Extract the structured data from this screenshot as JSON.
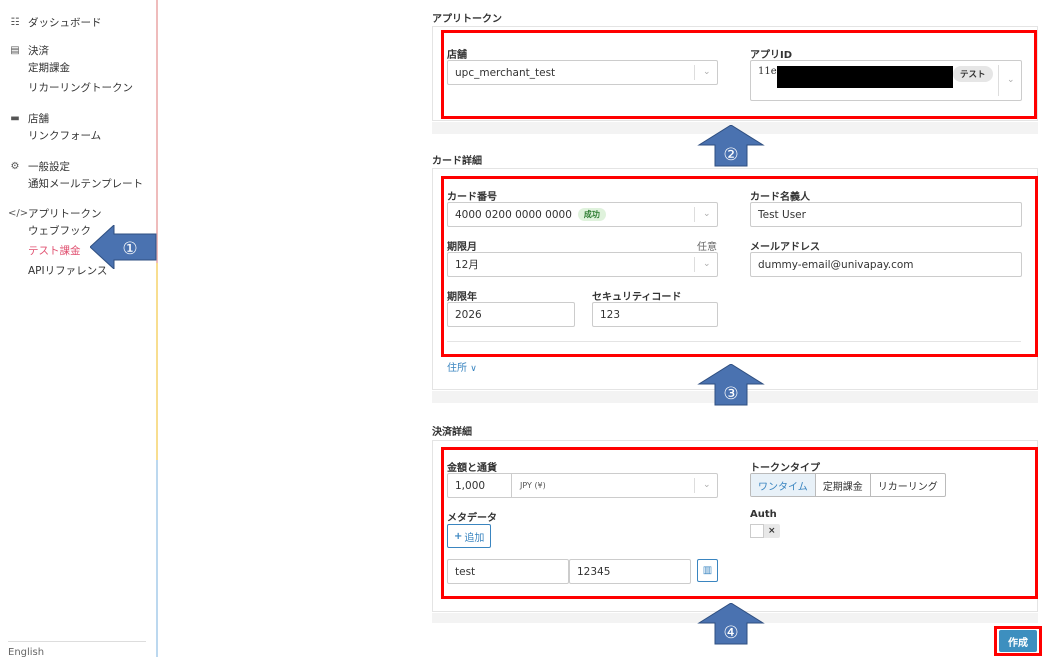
{
  "sidebar": {
    "dashboard": "ダッシュボード",
    "payments": "決済",
    "subscriptions": "定期課金",
    "recurring_tokens": "リカーリングトークン",
    "stores": "店舗",
    "link_form": "リンクフォーム",
    "general_settings": "一般設定",
    "mail_templates": "通知メールテンプレート",
    "app_tokens": "アプリトークン",
    "webhooks": "ウェブフック",
    "test_charge": "テスト課金",
    "api_reference": "APIリファレンス",
    "language": "English"
  },
  "app_token_section": {
    "title": "アプリトークン",
    "store_label": "店舗",
    "store_value": "upc_merchant_test",
    "app_id_label": "アプリID",
    "app_id_prefix": "11ec",
    "app_id_badge": "テスト"
  },
  "card_section": {
    "title": "カード詳細",
    "card_number_label": "カード番号",
    "card_number_value": "4000 0200 0000 0000",
    "card_number_badge": "成功",
    "holder_label": "カード名義人",
    "holder_value": "Test User",
    "exp_month_label": "期限月",
    "exp_month_optional": "任意",
    "exp_month_value": "12月",
    "email_label": "メールアドレス",
    "email_value": "dummy-email@univapay.com",
    "exp_year_label": "期限年",
    "exp_year_value": "2026",
    "cvv_label": "セキュリティコード",
    "cvv_value": "123",
    "address_link": "住所"
  },
  "payment_section": {
    "title": "決済詳細",
    "amount_label": "金額と通貨",
    "amount_value": "1,000",
    "currency_value": "JPY (¥)",
    "token_type_label": "トークンタイプ",
    "token_types": [
      "ワンタイム",
      "定期課金",
      "リカーリング"
    ],
    "metadata_label": "メタデータ",
    "add_button": "追加",
    "meta_key": "test",
    "meta_value": "12345",
    "auth_label": "Auth",
    "auth_toggle": "×"
  },
  "create_button": "作成",
  "annotations": {
    "n1": "①",
    "n2": "②",
    "n3": "③",
    "n4": "④"
  },
  "colors": {
    "annotation_red": "#ff0000",
    "arrow_blue": "#4a72b0",
    "accent_pink": "#e05070",
    "link_blue": "#3a85c0",
    "create_button": "#3d8fbf"
  }
}
